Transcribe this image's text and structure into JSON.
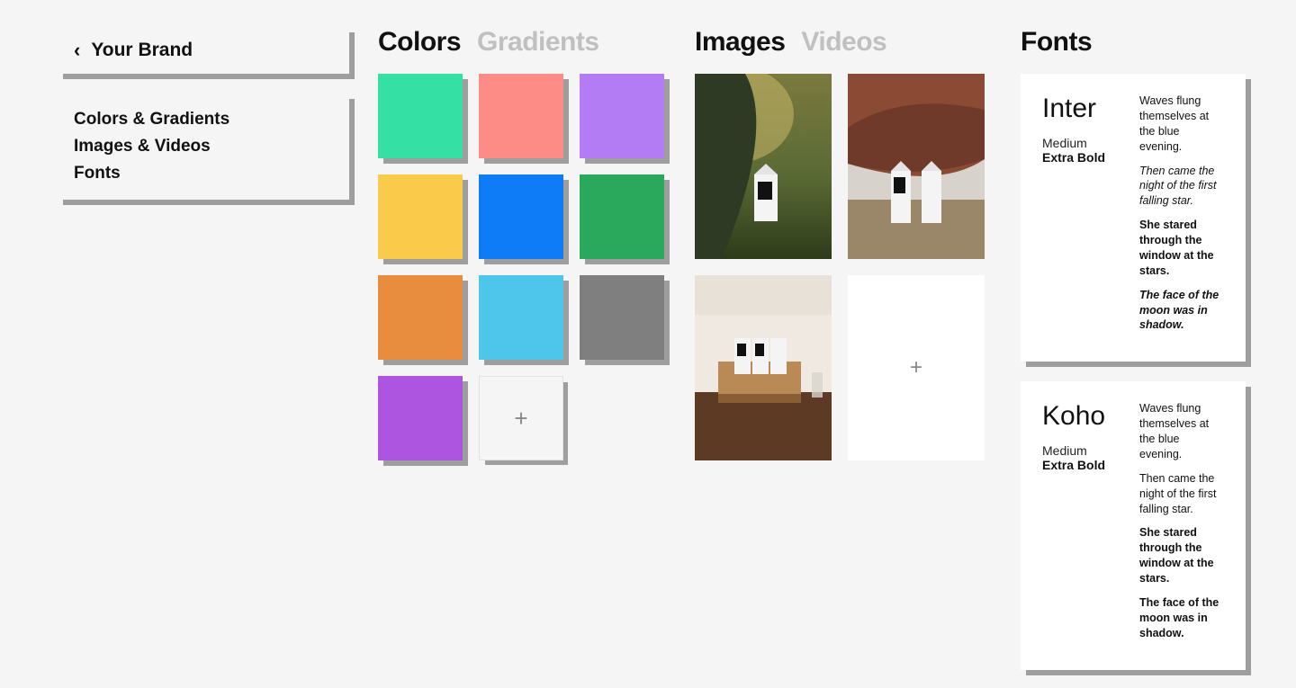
{
  "sidebar": {
    "title": "Your Brand",
    "items": [
      {
        "label": "Colors & Gradients"
      },
      {
        "label": "Images & Videos"
      },
      {
        "label": "Fonts"
      }
    ]
  },
  "colors_section": {
    "tabs": [
      {
        "label": "Colors",
        "active": true
      },
      {
        "label": "Gradients",
        "active": false
      }
    ],
    "swatches": [
      "#34e0a4",
      "#fc8c85",
      "#b37cf5",
      "#facb4b",
      "#0e7cf7",
      "#2aa85b",
      "#e88c3e",
      "#4ec6ec",
      "#7f7f7f",
      "#ad55e0"
    ],
    "add_icon": "+"
  },
  "images_section": {
    "tabs": [
      {
        "label": "Images",
        "active": true
      },
      {
        "label": "Videos",
        "active": false
      }
    ],
    "image_alts": [
      "boxed-water-carton-in-forest",
      "two-cartons-red-rock-desert",
      "wooden-tray-cartons-bedside"
    ],
    "add_icon": "+"
  },
  "fonts_section": {
    "heading": "Fonts",
    "cards": [
      {
        "name": "Inter",
        "weight1": "Medium",
        "weight2": "Extra Bold",
        "samples": [
          {
            "text": "Waves flung themselves at the blue evening.",
            "style": "regular"
          },
          {
            "text": "Then came the night of the first falling star.",
            "style": "italic"
          },
          {
            "text": "She stared through the window at the stars.",
            "style": "bold"
          },
          {
            "text": "The face of the moon was in shadow.",
            "style": "bolditalic"
          }
        ]
      },
      {
        "name": "Koho",
        "weight1": "Medium",
        "weight2": "Extra Bold",
        "samples": [
          {
            "text": "Waves flung themselves at the blue evening.",
            "style": "regular"
          },
          {
            "text": "Then came the night of the first falling star.",
            "style": "regular"
          },
          {
            "text": "She stared through the window at the stars.",
            "style": "bold"
          },
          {
            "text": "The face of the moon was in shadow.",
            "style": "bold"
          }
        ]
      }
    ]
  }
}
